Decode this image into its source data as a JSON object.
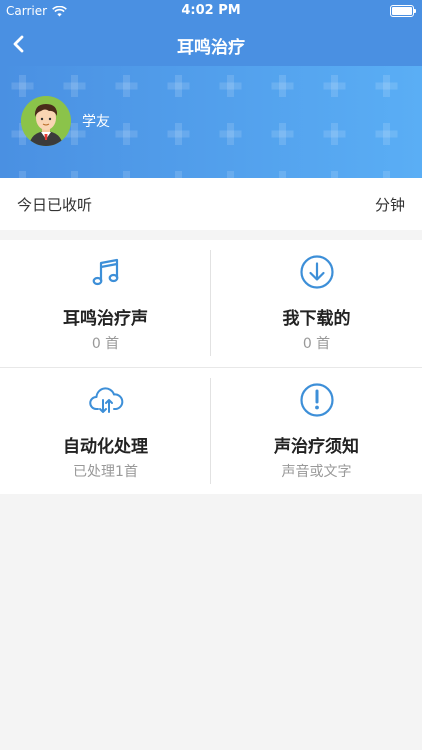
{
  "status_bar": {
    "carrier": "Carrier",
    "time": "4:02 PM"
  },
  "nav": {
    "title": "耳鸣治疗",
    "back_icon": "chevron-left-icon"
  },
  "profile": {
    "name": "学友",
    "avatar_icon": "user-avatar-icon"
  },
  "today": {
    "label": "今日已收听",
    "value": "分钟"
  },
  "grid": [
    {
      "title": "耳鸣治疗声",
      "subtitle": "0 首",
      "icon": "music-note-icon"
    },
    {
      "title": "我下载的",
      "subtitle": "0 首",
      "icon": "download-icon"
    },
    {
      "title": "自动化处理",
      "subtitle": "已处理1首",
      "icon": "cloud-sync-icon"
    },
    {
      "title": "声治疗须知",
      "subtitle": "声音或文字",
      "icon": "exclamation-icon"
    }
  ],
  "colors": {
    "primary": "#4a90e2",
    "icon_blue": "#3d8fd8",
    "background": "#f4f4f4"
  }
}
